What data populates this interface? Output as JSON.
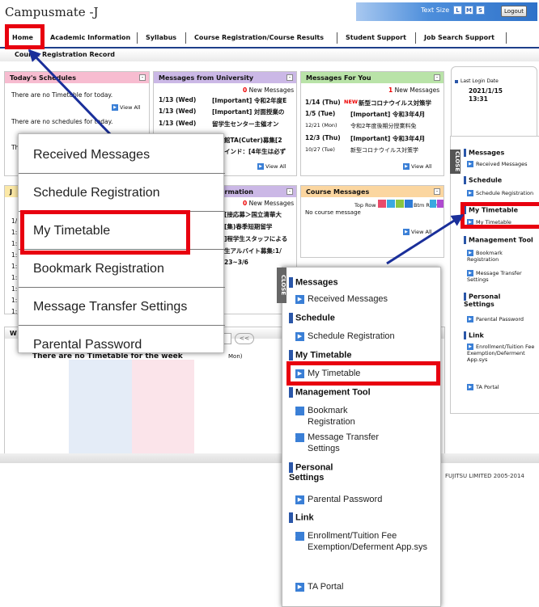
{
  "app": {
    "title": "Campusmate -J",
    "text_size_label": "Text Size",
    "sizes": [
      "L",
      "M",
      "S"
    ],
    "logout": "Logout"
  },
  "nav": {
    "items": [
      "Home",
      "Academic Information",
      "Syllabus",
      "Course Registration/Course Results",
      "Student Support",
      "Job Search Support"
    ],
    "sub_item": "Course Registration Record"
  },
  "panels": {
    "schedules": {
      "title": "Today's Schedules",
      "line1": "There are no Timetable for today.",
      "line2": "There are no schedules for today.",
      "line3": "Th",
      "view_all": "View All"
    },
    "university": {
      "title": "Messages from University",
      "count": "0",
      "count_label": "New Messages",
      "rows": [
        {
          "date": "1/13 (Wed)",
          "text": "[Important] 令和2年度E"
        },
        {
          "date": "1/13 (Wed)",
          "text": "[Important] 対面授業の"
        },
        {
          "date": "1/13 (Wed)",
          "text": "留学生センター主催オン"
        }
      ],
      "partial_rows": [
        "館TA(Cuter)募集[2",
        "インド：[4年生は必ず"
      ],
      "view_all": "View All"
    },
    "for_you": {
      "title": "Messages For You",
      "count": "1",
      "count_label": "New Messages",
      "rows": [
        {
          "date": "1/14 (Thu)",
          "new": "NEW",
          "text": "新型コロナウイルス対策学"
        },
        {
          "date": "1/5 (Tue)",
          "new": "",
          "text": "[Important] 令和3年4月"
        },
        {
          "date": "12/21 (Mon)",
          "new": "",
          "text": "令和2年度後期分授業料免"
        },
        {
          "date": "12/3 (Thu)",
          "new": "",
          "text": "[Important] 令和3年4月"
        },
        {
          "date": "10/27 (Tue)",
          "new": "",
          "text": "新型コロナウイルス対策学"
        }
      ],
      "view_all": "View All"
    },
    "last_login": {
      "label": "Last Login Date",
      "date": "2021/1/15",
      "time": "13:31"
    },
    "info": {
      "title": "ormation",
      "count": "0",
      "count_label": "New Messages",
      "rows": [
        "[接応募＞国立清華大",
        "[集)春季短期留学",
        "]程学生スタッフによる",
        "生アルバイト募集:1/",
        "23~3/6"
      ]
    },
    "course": {
      "title": "Course Messages",
      "row_label": "Top Row",
      "btm_label": "Btm Row",
      "no_msg": "No course message",
      "view_all": "View All"
    },
    "week_left": "W",
    "left_letter": "J",
    "left_rows": [
      "1/",
      "1:",
      "1:",
      "1:",
      "1:",
      "1:",
      "1:",
      "1:",
      "1:"
    ],
    "week_mon": "Mon)",
    "week_nav": "<<",
    "timetable_caption": "There are no Timetable for the week"
  },
  "callout1": {
    "items": [
      "Received Messages",
      "Schedule Registration",
      "My Timetable",
      "Bookmark Registration",
      "Message Transfer Settings",
      "Parental Password"
    ]
  },
  "callout2": {
    "close": "CLOSE",
    "sections": [
      {
        "title": "Messages",
        "items": [
          "Received Messages"
        ]
      },
      {
        "title": "Schedule",
        "items": [
          "Schedule Registration"
        ]
      },
      {
        "title": "My Timetable",
        "items": [
          "My Timetable"
        ]
      },
      {
        "title": "Management Tool",
        "items": [
          "Bookmark Registration",
          "Message Transfer Settings"
        ]
      },
      {
        "title": "Personal Settings",
        "items": [
          "Parental Password"
        ]
      },
      {
        "title": "Link",
        "items": [
          "Enrollment/Tuition Fee Exemption/Deferment App.sys",
          "TA Portal"
        ]
      }
    ]
  },
  "right_sidebar": {
    "close": "CLOSE",
    "sections": [
      {
        "title": "Messages",
        "items": [
          "Received Messages"
        ]
      },
      {
        "title": "Schedule",
        "items": [
          "Schedule Registration"
        ]
      },
      {
        "title": "My Timetable",
        "items": [
          "My Timetable"
        ]
      },
      {
        "title": "Management Tool",
        "items": [
          "Bookmark Registration",
          "Message Transfer Settings"
        ]
      },
      {
        "title": "Personal Settings",
        "items": [
          "Parental Password"
        ]
      },
      {
        "title": "Link",
        "items": [
          "Enrollment/Tuition Fee Exemption/Deferment App.sys",
          "TA Portal"
        ]
      }
    ]
  },
  "footer": {
    "copyright": "FUJITSU LIMITED 2005-2014"
  },
  "colors": {
    "accent_red": "#e8000f",
    "nav_blue": "#1e3f8a",
    "arrow_blue": "#1a2f9a",
    "icon_blue": "#3a7fd6"
  }
}
